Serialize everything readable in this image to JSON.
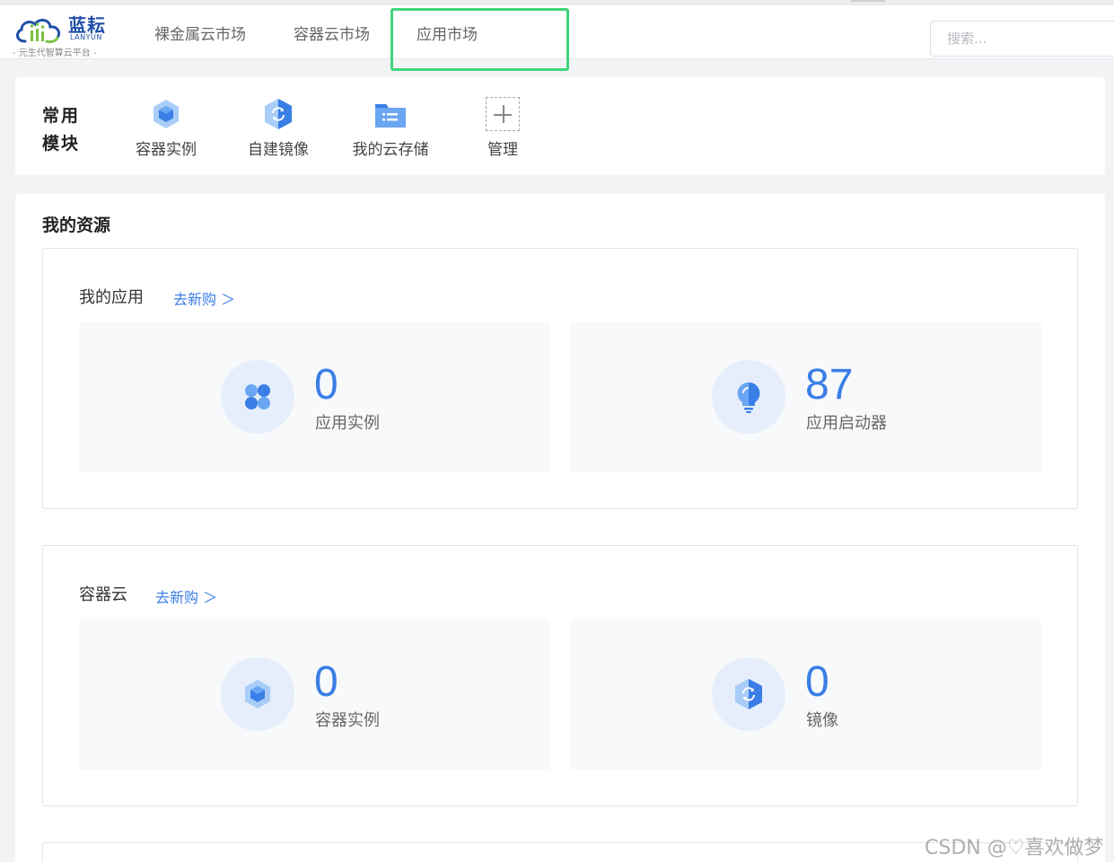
{
  "header": {
    "logo": {
      "cn": "蓝耘",
      "en": "LANYUN",
      "slogan": "- 元生代智算云平台 -"
    },
    "nav": [
      "裸金属云市场",
      "容器云市场",
      "应用市场"
    ],
    "search_placeholder": "搜索..."
  },
  "quick_modules": {
    "title": "常用模块",
    "items": [
      {
        "label": "容器实例",
        "icon": "cube-icon"
      },
      {
        "label": "自建镜像",
        "icon": "image-icon"
      },
      {
        "label": "我的云存储",
        "icon": "folder-icon"
      },
      {
        "label": "管理",
        "icon": "plus-icon"
      }
    ]
  },
  "resources": {
    "title": "我的资源",
    "groups": [
      {
        "title": "我的应用",
        "link": "去新购 ＞",
        "cards": [
          {
            "value": "0",
            "label": "应用实例",
            "icon": "app-grid-icon"
          },
          {
            "value": "87",
            "label": "应用启动器",
            "icon": "bulb-icon"
          }
        ]
      },
      {
        "title": "容器云",
        "link": "去新购 ＞",
        "cards": [
          {
            "value": "0",
            "label": "容器实例",
            "icon": "cube-icon"
          },
          {
            "value": "0",
            "label": "镜像",
            "icon": "image-icon"
          }
        ]
      }
    ]
  },
  "watermark": "CSDN @♡喜欢做梦",
  "colors": {
    "accent": "#3a7ee6",
    "highlight": "#3ed67a"
  }
}
